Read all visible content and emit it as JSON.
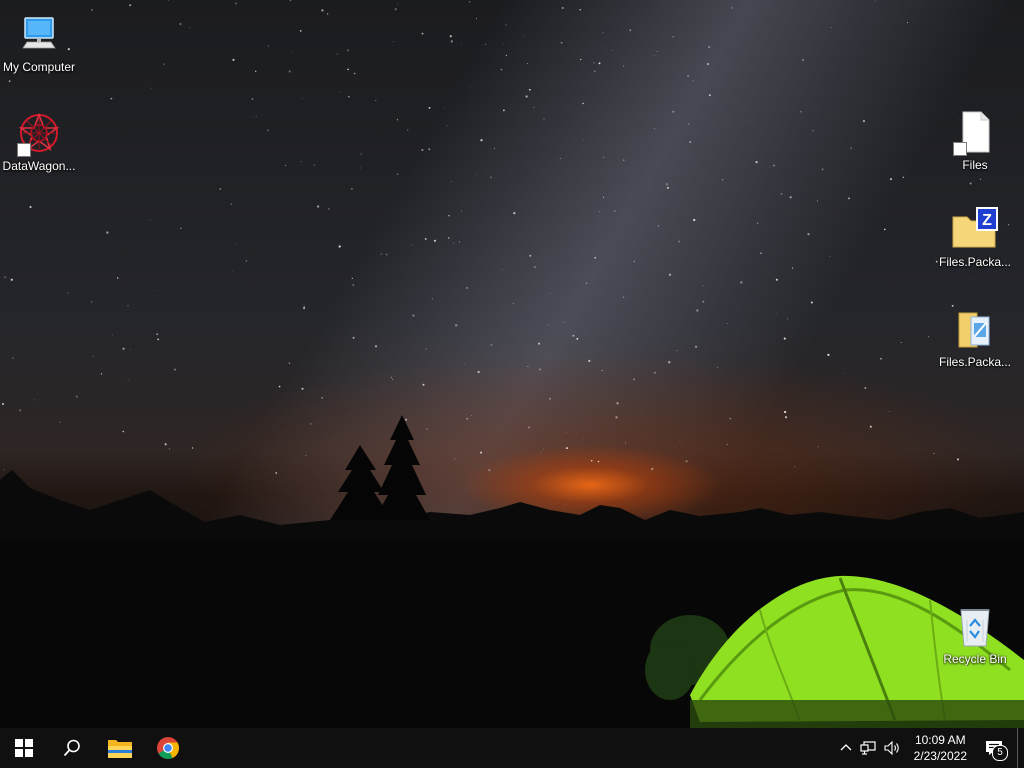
{
  "desktop": {
    "icons": [
      {
        "id": "my-computer",
        "label": "My Computer",
        "icon": "computer-icon"
      },
      {
        "id": "datawagon",
        "label": "DataWagon...",
        "icon": "datawagon-app-icon",
        "shortcut": true
      },
      {
        "id": "files",
        "label": "Files",
        "icon": "blank-document-icon",
        "shortcut": true
      },
      {
        "id": "files-package-zip",
        "label": "Files.Packa...",
        "icon": "zip-folder-icon"
      },
      {
        "id": "files-package-installer",
        "label": "Files.Packa...",
        "icon": "installer-package-icon"
      },
      {
        "id": "recycle-bin",
        "label": "Recycle Bin",
        "icon": "recycle-bin-icon"
      }
    ]
  },
  "taskbar": {
    "start": {
      "icon": "windows-start-icon"
    },
    "search": {
      "icon": "search-icon"
    },
    "pinned": [
      {
        "name": "File Explorer",
        "icon": "file-explorer-icon"
      },
      {
        "name": "Google Chrome",
        "icon": "chrome-icon"
      }
    ],
    "tray": {
      "chevron": "chevron-up-icon",
      "network": "network-icon",
      "volume": "volume-icon",
      "time": "10:09 AM",
      "date": "2/23/2022",
      "notification_count": "5"
    }
  },
  "colors": {
    "taskbar_bg": "#101010",
    "tent_green": "#8fe020",
    "horizon_orange": "#ff6e14"
  }
}
